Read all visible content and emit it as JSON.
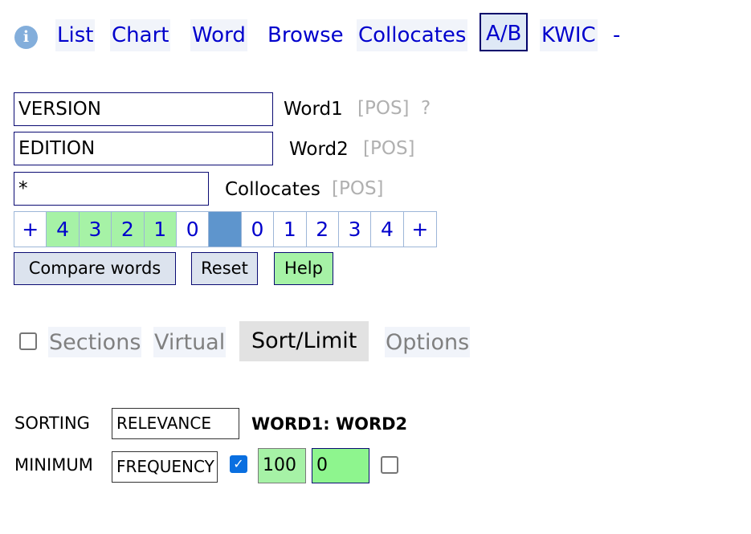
{
  "nav": {
    "info_icon_glyph": "i",
    "tabs": [
      "List",
      "Chart",
      "Word",
      "Browse",
      "Collocates",
      "A/B",
      "KWIC"
    ],
    "active_tab": "A/B",
    "dash": "-"
  },
  "search": {
    "word1_value": "VERSION",
    "word1_label": "Word1",
    "word1_pos": "[POS]",
    "help_mark": "?",
    "word2_value": "EDITION",
    "word2_label": "Word2",
    "word2_pos": "[POS]",
    "collocates_value": "*",
    "collocates_label": "Collocates",
    "collocates_pos": "[POS]"
  },
  "span": {
    "cells": [
      "+",
      "4",
      "3",
      "2",
      "1",
      "0",
      "",
      "0",
      "1",
      "2",
      "3",
      "4",
      "+"
    ],
    "selected_left": [
      "4",
      "3",
      "2",
      "1"
    ],
    "selected_right": []
  },
  "buttons": {
    "compare": "Compare words",
    "reset": "Reset",
    "help": "Help"
  },
  "sections": {
    "checkbox_checked": false,
    "tabs": [
      "Sections",
      "Virtual",
      "Sort/Limit",
      "Options"
    ],
    "active": "Sort/Limit"
  },
  "sort_limit": {
    "sorting_label": "SORTING",
    "sorting_value": "RELEVANCE",
    "sort_desc": "WORD1: WORD2",
    "minimum_label": "MINIMUM",
    "minimum_value": "FREQUENCY",
    "freq_checked": true,
    "min_word_freq": "100",
    "min_collocate_freq": "0",
    "extra_checked": false
  },
  "colors": {
    "link": "#0000cc",
    "active_border": "#00006b",
    "selected_span": "#a6f2a6",
    "node_span": "#5e95cd",
    "compare_bg": "#dce3ee",
    "help_bg": "#a6f2a6",
    "min_freq_bg": "#a6f2a6",
    "collocate_freq_bg": "#8ef58e"
  }
}
